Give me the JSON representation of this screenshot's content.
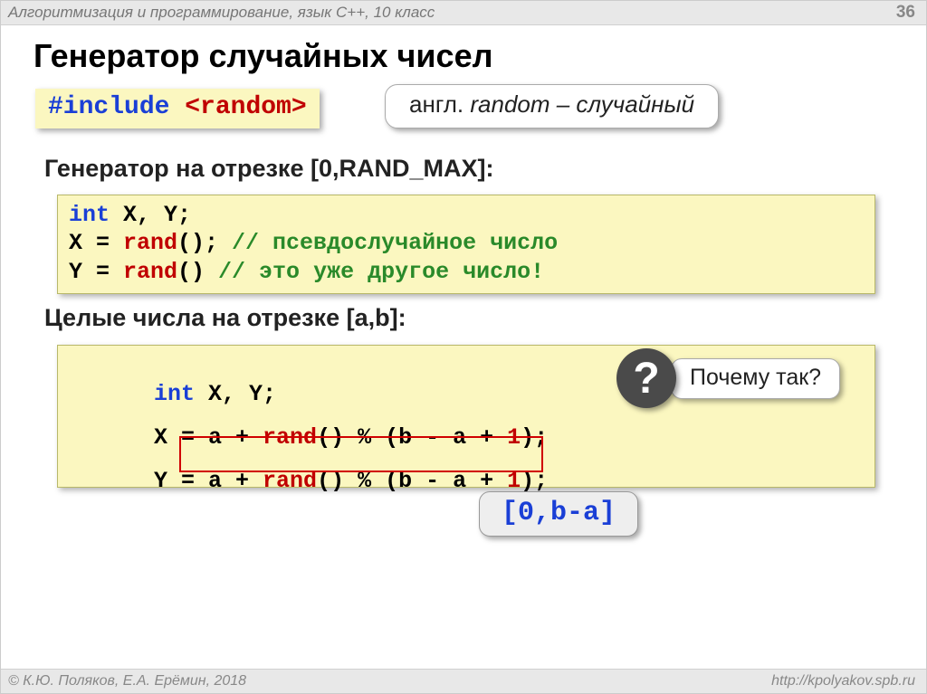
{
  "header": {
    "breadcrumb": "Алгоритмизация и программирование, язык  C++, 10 класс",
    "page": "36"
  },
  "title": "Генератор случайных чисел",
  "include": {
    "keyword": "#include",
    "header": "<random>"
  },
  "callout_random": {
    "prefix": "англ. ",
    "word": "random",
    "suffix": " – случайный"
  },
  "section1": {
    "heading": "Генератор на отрезке [0,RAND_MAX]:",
    "code": {
      "decl_kw": "int",
      "decl_rest": " X, Y;",
      "l2_lhs": "X = ",
      "l2_fn": "rand",
      "l2_after": "(); ",
      "l2_cmt": "// псевдослучайное число",
      "l3_lhs": "Y = ",
      "l3_fn": "rand",
      "l3_after": "()  ",
      "l3_cmt": "// это уже другое число!"
    }
  },
  "section2": {
    "heading": "Целые числа на отрезке [a,b]:",
    "code": {
      "decl_kw": "int",
      "decl_rest": " X, Y;",
      "l2_pre": "X = a + ",
      "l2_fn": "rand",
      "l2_mid": "() % (b - a + ",
      "l2_one": "1",
      "l2_end": ");",
      "l3_pre": "Y = a + ",
      "l3_fn": "rand",
      "l3_mid": "() % (b - a + ",
      "l3_one": "1",
      "l3_end": ");"
    }
  },
  "question": {
    "mark": "?",
    "text": "Почему так?"
  },
  "range_callout": "[0,b-a]",
  "footer": {
    "left": "© К.Ю. Поляков, Е.А. Ерёмин, 2018",
    "right": "http://kpolyakov.spb.ru"
  }
}
